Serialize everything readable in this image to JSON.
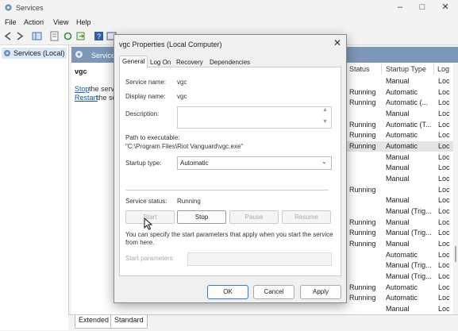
{
  "window": {
    "title": "Services"
  },
  "menu": [
    "File",
    "Action",
    "View",
    "Help"
  ],
  "tree": {
    "item": "Services (Local)"
  },
  "panel": {
    "header": "Service",
    "service_name": "vgc",
    "stop_link": "Stop",
    "stop_rest": "the serv",
    "restart_link": "Restart",
    "restart_rest": "the se"
  },
  "columns": {
    "status": "Status",
    "startup_type": "Startup Type",
    "log": "Log"
  },
  "rows": [
    {
      "status": "",
      "startup": "Manual",
      "log": "Loc"
    },
    {
      "status": "Running",
      "startup": "Automatic",
      "log": "Loc"
    },
    {
      "status": "Running",
      "startup": "Automatic (...",
      "log": "Loc"
    },
    {
      "status": "",
      "startup": "Manual",
      "log": "Loc"
    },
    {
      "status": "Running",
      "startup": "Automatic (T...",
      "log": "Loc"
    },
    {
      "status": "Running",
      "startup": "Automatic",
      "log": "Loc"
    },
    {
      "status": "Running",
      "startup": "Automatic",
      "log": "Loc"
    },
    {
      "status": "",
      "startup": "Manual",
      "log": "Loc"
    },
    {
      "status": "",
      "startup": "Manual",
      "log": "Loc"
    },
    {
      "status": "",
      "startup": "Manual",
      "log": "Loc"
    },
    {
      "status": "Running",
      "startup": "",
      "log": "Loc"
    },
    {
      "status": "",
      "startup": "Manual",
      "log": "Loc"
    },
    {
      "status": "",
      "startup": "Manual (Trig...",
      "log": "Loc"
    },
    {
      "status": "Running",
      "startup": "Manual",
      "log": "Loc"
    },
    {
      "status": "Running",
      "startup": "Manual (Trig...",
      "log": "Loc"
    },
    {
      "status": "Running",
      "startup": "Manual",
      "log": "Loc"
    },
    {
      "status": "",
      "startup": "Automatic",
      "log": "Loc"
    },
    {
      "status": "",
      "startup": "Manual (Trig...",
      "log": "Loc"
    },
    {
      "status": "",
      "startup": "Manual (Trig...",
      "log": "Loc"
    },
    {
      "status": "Running",
      "startup": "Automatic",
      "log": "Loc"
    },
    {
      "status": "Running",
      "startup": "Automatic",
      "log": "Loc"
    },
    {
      "status": "",
      "startup": "Manual",
      "log": "Loc"
    }
  ],
  "bottom_tabs": [
    "Extended",
    "Standard"
  ],
  "dialog": {
    "title": "vgc Properties (Local Computer)",
    "tabs": [
      "General",
      "Log On",
      "Recovery",
      "Dependencies"
    ],
    "service_name_label": "Service name:",
    "service_name": "vgc",
    "display_name_label": "Display name:",
    "display_name": "vgc",
    "description_label": "Description:",
    "path_label": "Path to executable:",
    "path": "\"C:\\Program Files\\Riot Vanguard\\vgc.exe\"",
    "startup_type_label": "Startup type:",
    "startup_type": "Automatic",
    "status_label": "Service status:",
    "status": "Running",
    "buttons": {
      "start": "Start",
      "stop": "Stop",
      "pause": "Pause",
      "resume": "Resume"
    },
    "hint": "You can specify the start parameters that apply when you start the service from here.",
    "params_label": "Start parameters:",
    "ok": "OK",
    "cancel": "Cancel",
    "apply": "Apply"
  },
  "colors": {
    "header_bg": "#7d97b8",
    "link": "#1558b0",
    "tree_selected": "#dbe8f8"
  }
}
